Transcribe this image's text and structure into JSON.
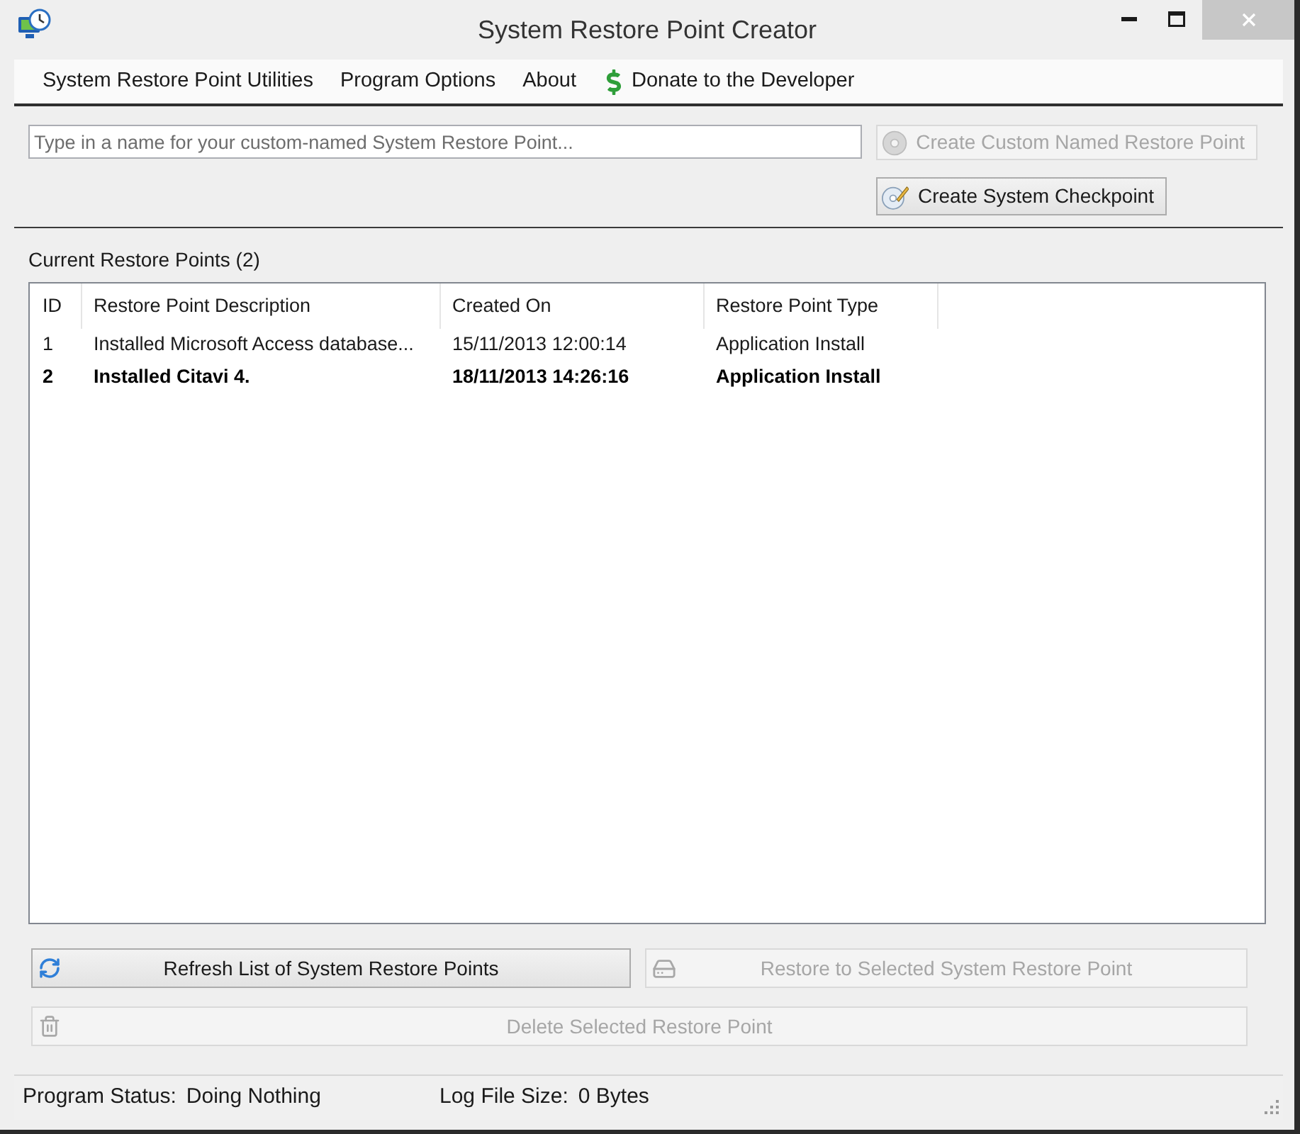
{
  "window": {
    "title": "System Restore Point Creator"
  },
  "menu": [
    {
      "label": "System Restore Point Utilities",
      "kind": "text"
    },
    {
      "label": "Program Options",
      "kind": "text"
    },
    {
      "label": "About",
      "kind": "text"
    },
    {
      "label": "Donate to the Developer",
      "kind": "icon_text"
    }
  ],
  "name_field": {
    "placeholder": "Type in a name for your custom-named System Restore Point..."
  },
  "create_custom_button": {
    "label": "Create Custom Named Restore Point",
    "disabled": true
  },
  "create_checkpoint_button": {
    "label": "Create System Checkpoint",
    "disabled": false
  },
  "list_title": "Current Restore Points (2)",
  "table": {
    "columns": [
      "ID",
      "Restore Point Description",
      "Created On",
      "Restore Point Type"
    ],
    "rows": [
      {
        "cells": [
          "1",
          "Installed Microsoft Access database...",
          "15/11/2013 12:00:14",
          "Application Install"
        ],
        "emphasized": false
      },
      {
        "cells": [
          "2",
          "Installed Citavi 4.",
          "18/11/2013 14:26:16",
          "Application Install"
        ],
        "emphasized": true
      }
    ]
  },
  "refresh_button": {
    "label": "Refresh List of System Restore Points",
    "disabled": false
  },
  "restore_button": {
    "label": "Restore to Selected System Restore Point",
    "disabled": true
  },
  "delete_button": {
    "label": "Delete Selected Restore Point",
    "disabled": true
  },
  "status_bar": [
    {
      "label": "Program Status:",
      "value": "Doing Nothing"
    },
    {
      "label": "Log File Size:",
      "value": "0 Bytes"
    }
  ]
}
